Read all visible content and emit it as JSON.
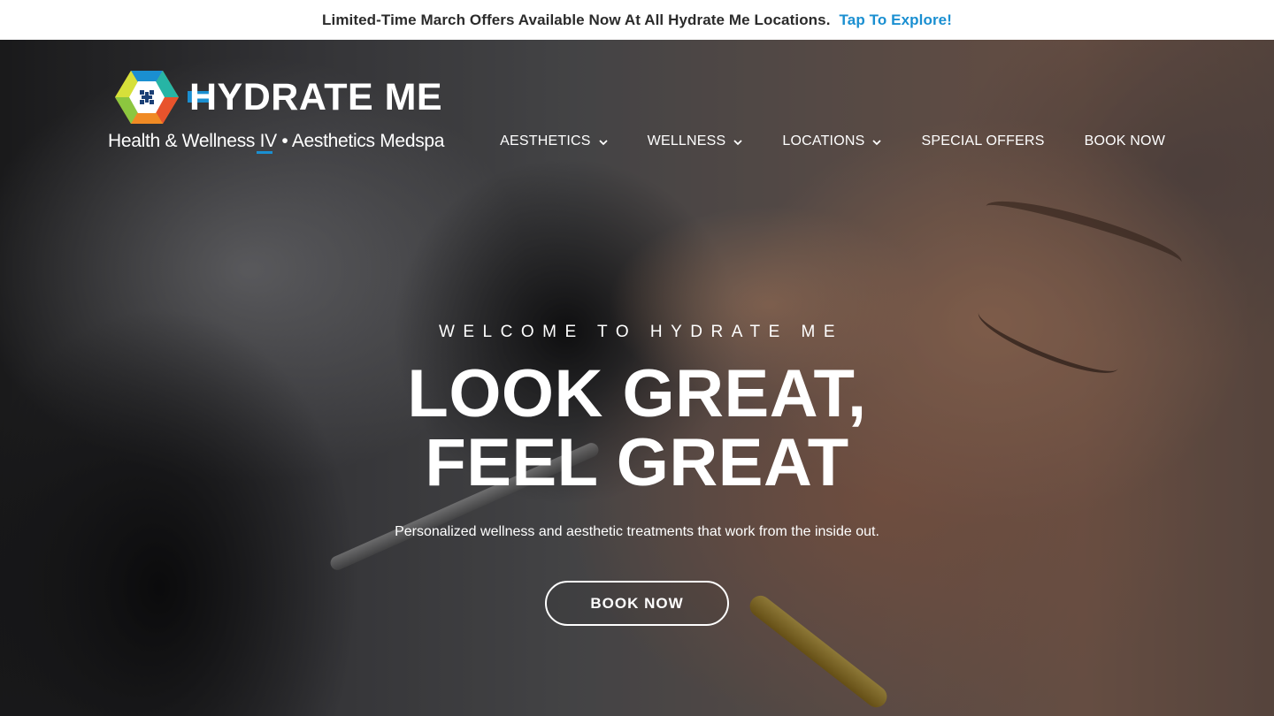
{
  "promo": {
    "text": "Limited-Time March Offers Available Now At All Hydrate Me Locations.",
    "link": "Tap To Explore!"
  },
  "logo": {
    "wordmark": "HYDRATE ME",
    "tagline": "Health & Wellness IV • Aesthetics Medspa",
    "icon": "hexagon-cross-logo"
  },
  "nav": {
    "items": [
      {
        "label": "AESTHETICS",
        "icon": "chevron-down-icon"
      },
      {
        "label": "WELLNESS",
        "icon": "chevron-down-icon"
      },
      {
        "label": "LOCATIONS",
        "icon": "chevron-down-icon"
      },
      {
        "label": "SPECIAL OFFERS"
      },
      {
        "label": "BOOK NOW"
      }
    ]
  },
  "hero": {
    "eyebrow": "WELCOME TO HYDRATE ME",
    "headline_line1": "LOOK GREAT,",
    "headline_line2": "FEEL GREAT",
    "subhead": "Personalized wellness and aesthetic treatments that work from the inside out.",
    "cta": "BOOK NOW"
  },
  "colors": {
    "accent": "#1a8fd1",
    "promo_text": "#2b2b2b",
    "hero_text": "#ffffff"
  }
}
